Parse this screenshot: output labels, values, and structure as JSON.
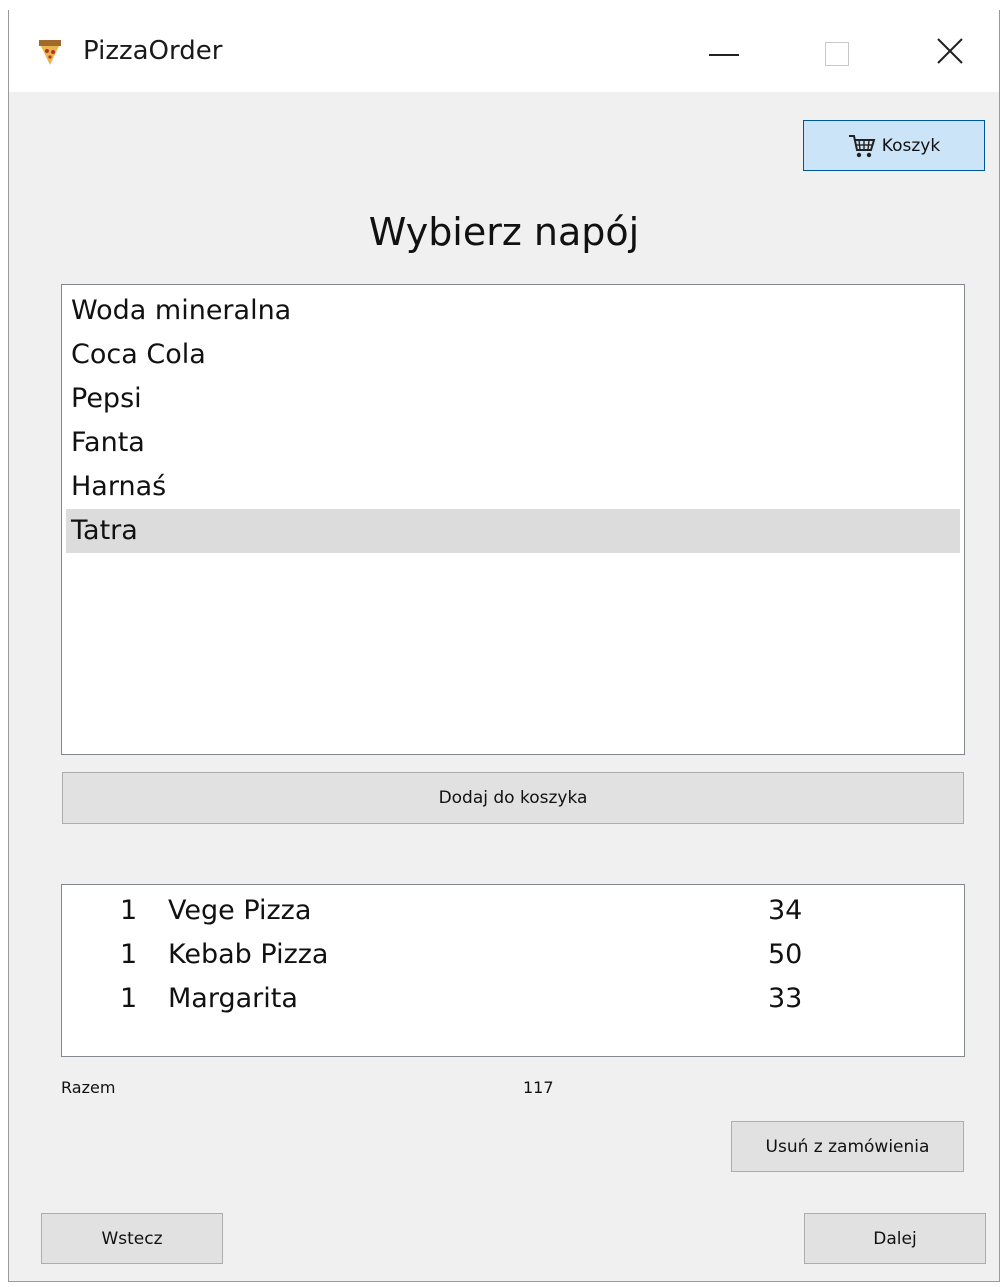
{
  "window": {
    "title": "PizzaOrder"
  },
  "toolbar": {
    "cart_label": "Koszyk"
  },
  "heading": "Wybierz napój",
  "drinks": {
    "items": [
      "Woda mineralna",
      "Coca Cola",
      "Pepsi",
      "Fanta",
      "Harnaś",
      "Tatra"
    ],
    "selected": "Tatra"
  },
  "add_button_label": "Dodaj do koszyka",
  "order": {
    "rows": [
      {
        "qty": "1",
        "name": "Vege Pizza",
        "price": "34"
      },
      {
        "qty": "1",
        "name": "Kebab Pizza",
        "price": "50"
      },
      {
        "qty": "1",
        "name": "Margarita",
        "price": "33"
      }
    ]
  },
  "total": {
    "label": "Razem",
    "value": "117"
  },
  "remove_button_label": "Usuń z zamówienia",
  "back_button_label": "Wstecz",
  "next_button_label": "Dalej",
  "colors": {
    "window_bg": "#f0f0f0",
    "cart_button_bg": "#cce4f7",
    "selection_bg": "#dcdcdc"
  }
}
